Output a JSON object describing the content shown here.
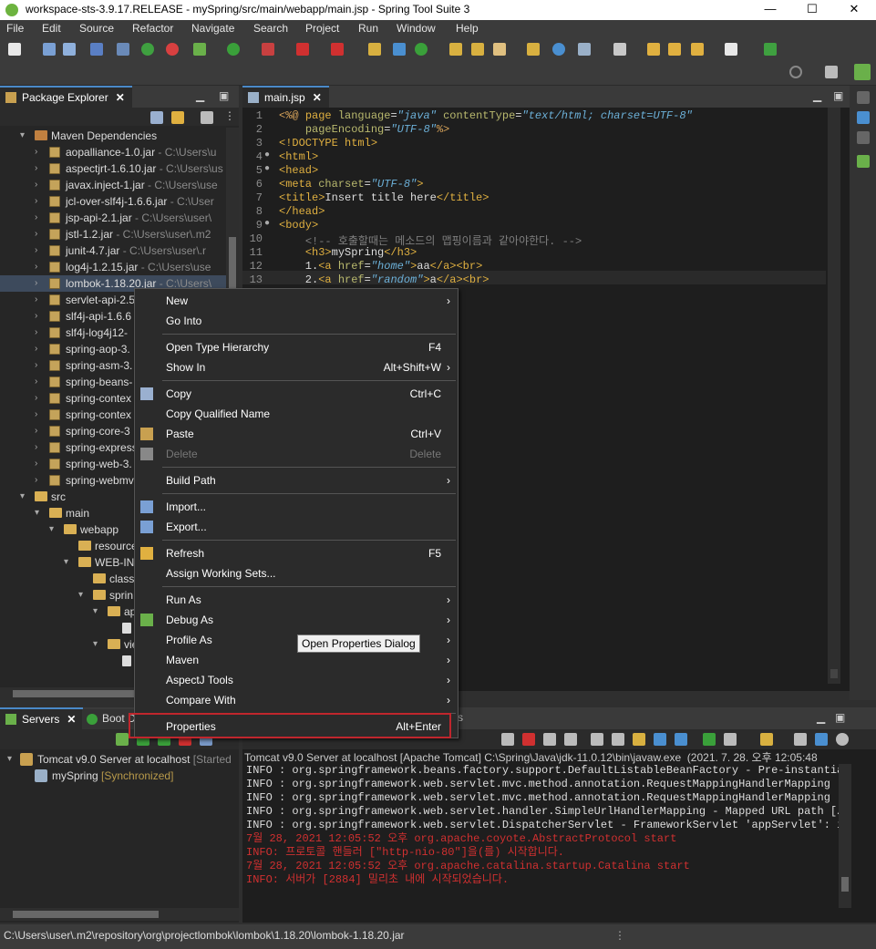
{
  "window": {
    "title": "workspace-sts-3.9.17.RELEASE - mySpring/src/main/webapp/main.jsp - Spring Tool Suite 3",
    "minimize": "—",
    "maximize": "☐",
    "close": "✕"
  },
  "menu": [
    "File",
    "Edit",
    "Source",
    "Refactor",
    "Navigate",
    "Search",
    "Project",
    "Run",
    "Window",
    "Help"
  ],
  "package_explorer": {
    "tab_label": "Package Explorer",
    "items": [
      {
        "label": "Maven Dependencies",
        "path": ""
      },
      {
        "label": "aopalliance-1.0.jar",
        "path": " - C:\\Users\\u"
      },
      {
        "label": "aspectjrt-1.6.10.jar",
        "path": " - C:\\Users\\us"
      },
      {
        "label": "javax.inject-1.jar",
        "path": " - C:\\Users\\use"
      },
      {
        "label": "jcl-over-slf4j-1.6.6.jar",
        "path": " - C:\\User"
      },
      {
        "label": "jsp-api-2.1.jar",
        "path": " - C:\\Users\\user\\"
      },
      {
        "label": "jstl-1.2.jar",
        "path": " - C:\\Users\\user\\.m2"
      },
      {
        "label": "junit-4.7.jar",
        "path": " - C:\\Users\\user\\.r"
      },
      {
        "label": "log4j-1.2.15.jar",
        "path": " - C:\\Users\\use"
      },
      {
        "label": "lombok-1.18.20.jar",
        "path": " - C:\\Users\\"
      },
      {
        "label": "servlet-api-2.5",
        "path": ""
      },
      {
        "label": "slf4j-api-1.6.6",
        "path": ""
      },
      {
        "label": "slf4j-log4j12-",
        "path": ""
      },
      {
        "label": "spring-aop-3.",
        "path": ""
      },
      {
        "label": "spring-asm-3.",
        "path": ""
      },
      {
        "label": "spring-beans-",
        "path": ""
      },
      {
        "label": "spring-contex",
        "path": ""
      },
      {
        "label": "spring-contex",
        "path": ""
      },
      {
        "label": "spring-core-3",
        "path": ""
      },
      {
        "label": "spring-express",
        "path": ""
      },
      {
        "label": "spring-web-3.",
        "path": ""
      },
      {
        "label": "spring-webmv",
        "path": ""
      },
      {
        "label": "src",
        "path": ""
      },
      {
        "label": "main",
        "path": ""
      },
      {
        "label": "webapp",
        "path": ""
      },
      {
        "label": "resource",
        "path": ""
      },
      {
        "label": "WEB-IN",
        "path": ""
      },
      {
        "label": "class",
        "path": ""
      },
      {
        "label": "sprin",
        "path": ""
      },
      {
        "label": "ap",
        "path": ""
      },
      {
        "label": "ro",
        "path": ""
      },
      {
        "label": "views",
        "path": ""
      },
      {
        "label": "ho",
        "path": ""
      }
    ]
  },
  "editor": {
    "tab_label": "main.jsp",
    "lines": [
      {
        "n": "1",
        "segs": [
          [
            "kw",
            "<%@ "
          ],
          [
            "tag",
            "page "
          ],
          [
            "attr",
            "language"
          ],
          [
            "",
            "="
          ],
          [
            "str",
            "\"java\""
          ],
          [
            "",
            " "
          ],
          [
            "attr",
            "contentType"
          ],
          [
            "",
            "="
          ],
          [
            "str",
            "\"text/html; charset=UTF-8\""
          ]
        ]
      },
      {
        "n": "2",
        "segs": [
          [
            "",
            "    "
          ],
          [
            "attr",
            "pageEncoding"
          ],
          [
            "",
            "="
          ],
          [
            "str",
            "\"UTF-8\""
          ],
          [
            "kw",
            "%>"
          ]
        ]
      },
      {
        "n": "3",
        "segs": [
          [
            "tag",
            "<!DOCTYPE html>"
          ]
        ]
      },
      {
        "n": "4",
        "segs": [
          [
            "tag",
            "<html>"
          ]
        ]
      },
      {
        "n": "5",
        "segs": [
          [
            "tag",
            "<head>"
          ]
        ]
      },
      {
        "n": "6",
        "segs": [
          [
            "tag",
            "<meta "
          ],
          [
            "attr",
            "charset"
          ],
          [
            "",
            "="
          ],
          [
            "str",
            "\"UTF-8\""
          ],
          [
            "tag",
            ">"
          ]
        ]
      },
      {
        "n": "7",
        "segs": [
          [
            "tag",
            "<title>"
          ],
          [
            "",
            "Insert title here"
          ],
          [
            "tag",
            "</title>"
          ]
        ]
      },
      {
        "n": "8",
        "segs": [
          [
            "tag",
            "</head>"
          ]
        ]
      },
      {
        "n": "9",
        "segs": [
          [
            "tag",
            "<body>"
          ]
        ]
      },
      {
        "n": "10",
        "segs": [
          [
            "",
            "    "
          ],
          [
            "cmt",
            "<!-- 호출할때는 메소드의 맵핑이름과 같아야한다. -->"
          ]
        ]
      },
      {
        "n": "11",
        "segs": [
          [
            "",
            "    "
          ],
          [
            "tag",
            "<h3>"
          ],
          [
            "",
            "mySpring"
          ],
          [
            "tag",
            "</h3>"
          ]
        ]
      },
      {
        "n": "12",
        "segs": [
          [
            "",
            "    1."
          ],
          [
            "tag",
            "<a "
          ],
          [
            "attr",
            "href"
          ],
          [
            "",
            "="
          ],
          [
            "str",
            "\"home\""
          ],
          [
            "tag",
            ">"
          ],
          [
            "",
            "aa"
          ],
          [
            "tag",
            "</a><br>"
          ]
        ]
      },
      {
        "n": "13",
        "segs": [
          [
            "",
            "    2."
          ],
          [
            "tag",
            "<a "
          ],
          [
            "attr",
            "href"
          ],
          [
            "",
            "="
          ],
          [
            "str",
            "\"random\""
          ],
          [
            "tag",
            ">"
          ],
          [
            "",
            "a"
          ],
          [
            "tag",
            "</a><br>"
          ]
        ]
      }
    ]
  },
  "context_menu": {
    "items": [
      {
        "label": "New",
        "shortcut": "",
        "submenu": true,
        "disabled": false
      },
      {
        "label": "Go Into",
        "shortcut": "",
        "submenu": false,
        "disabled": false
      },
      {
        "sep": true
      },
      {
        "label": "Open Type Hierarchy",
        "shortcut": "F4",
        "submenu": false,
        "disabled": false
      },
      {
        "label": "Show In",
        "shortcut": "Alt+Shift+W",
        "submenu": true,
        "disabled": false
      },
      {
        "sep": true
      },
      {
        "label": "Copy",
        "shortcut": "Ctrl+C",
        "submenu": false,
        "disabled": false,
        "icon": "copy-icon"
      },
      {
        "label": "Copy Qualified Name",
        "shortcut": "",
        "submenu": false,
        "disabled": false
      },
      {
        "label": "Paste",
        "shortcut": "Ctrl+V",
        "submenu": false,
        "disabled": false,
        "icon": "paste-icon"
      },
      {
        "label": "Delete",
        "shortcut": "Delete",
        "submenu": false,
        "disabled": true,
        "icon": "delete-icon"
      },
      {
        "sep": true
      },
      {
        "label": "Build Path",
        "shortcut": "",
        "submenu": true,
        "disabled": false
      },
      {
        "sep": true
      },
      {
        "label": "Import...",
        "shortcut": "",
        "submenu": false,
        "disabled": false,
        "icon": "import-icon"
      },
      {
        "label": "Export...",
        "shortcut": "",
        "submenu": false,
        "disabled": false,
        "icon": "export-icon"
      },
      {
        "sep": true
      },
      {
        "label": "Refresh",
        "shortcut": "F5",
        "submenu": false,
        "disabled": false,
        "icon": "refresh-icon"
      },
      {
        "label": "Assign Working Sets...",
        "shortcut": "",
        "submenu": false,
        "disabled": false
      },
      {
        "sep": true
      },
      {
        "label": "Run As",
        "shortcut": "",
        "submenu": true,
        "disabled": false
      },
      {
        "label": "Debug As",
        "shortcut": "",
        "submenu": true,
        "disabled": false,
        "icon": "debug-icon"
      },
      {
        "label": "Profile As",
        "shortcut": "",
        "submenu": true,
        "disabled": false
      },
      {
        "label": "Maven",
        "shortcut": "",
        "submenu": true,
        "disabled": false
      },
      {
        "label": "AspectJ Tools",
        "shortcut": "",
        "submenu": true,
        "disabled": false
      },
      {
        "label": "Compare With",
        "shortcut": "",
        "submenu": true,
        "disabled": false
      },
      {
        "sep": true
      },
      {
        "label": "Properties",
        "shortcut": "Alt+Enter",
        "submenu": false,
        "disabled": false
      }
    ],
    "tooltip": "Open Properties Dialog"
  },
  "servers": {
    "tab_label": "Servers",
    "tab2_label": "Boot D",
    "server": "Tomcat v9.0 Server at localhost",
    "server_state": "[Started",
    "module": "mySpring",
    "module_state": "[Synchronized]"
  },
  "console": {
    "tab_suffix": "s",
    "header": "Tomcat v9.0 Server at localhost [Apache Tomcat] C:\\Spring\\Java\\jdk-11.0.12\\bin\\javaw.exe  (2021. 7. 28. 오후 12:05:48",
    "lines": [
      {
        "t": "INFO : org.springframework.beans.factory.support.DefaultListableBeanFactory - Pre-instantiati",
        "red": false
      },
      {
        "t": "INFO : org.springframework.web.servlet.mvc.method.annotation.RequestMappingHandlerMapping - M",
        "red": false
      },
      {
        "t": "INFO : org.springframework.web.servlet.mvc.method.annotation.RequestMappingHandlerMapping - M",
        "red": false
      },
      {
        "t": "INFO : org.springframework.web.servlet.handler.SimpleUrlHandlerMapping - Mapped URL path [/re",
        "red": false
      },
      {
        "t": "INFO : org.springframework.web.servlet.DispatcherServlet - FrameworkServlet 'appServlet': ini",
        "red": false
      },
      {
        "t": "7월 28, 2021 12:05:52 오후 org.apache.coyote.AbstractProtocol start",
        "red": true
      },
      {
        "t": "INFO: 프로토콜 핸들러 [\"http-nio-80\"]을(를) 시작합니다.",
        "red": true
      },
      {
        "t": "7월 28, 2021 12:05:52 오후 org.apache.catalina.startup.Catalina start",
        "red": true
      },
      {
        "t": "INFO: 서버가 [2884] 밀리초 내에 시작되었습니다.",
        "red": true
      }
    ]
  },
  "status_bar": {
    "path": "C:\\Users\\user\\.m2\\repository\\org\\projectlombok\\lombok\\1.18.20\\lombok-1.18.20.jar"
  }
}
